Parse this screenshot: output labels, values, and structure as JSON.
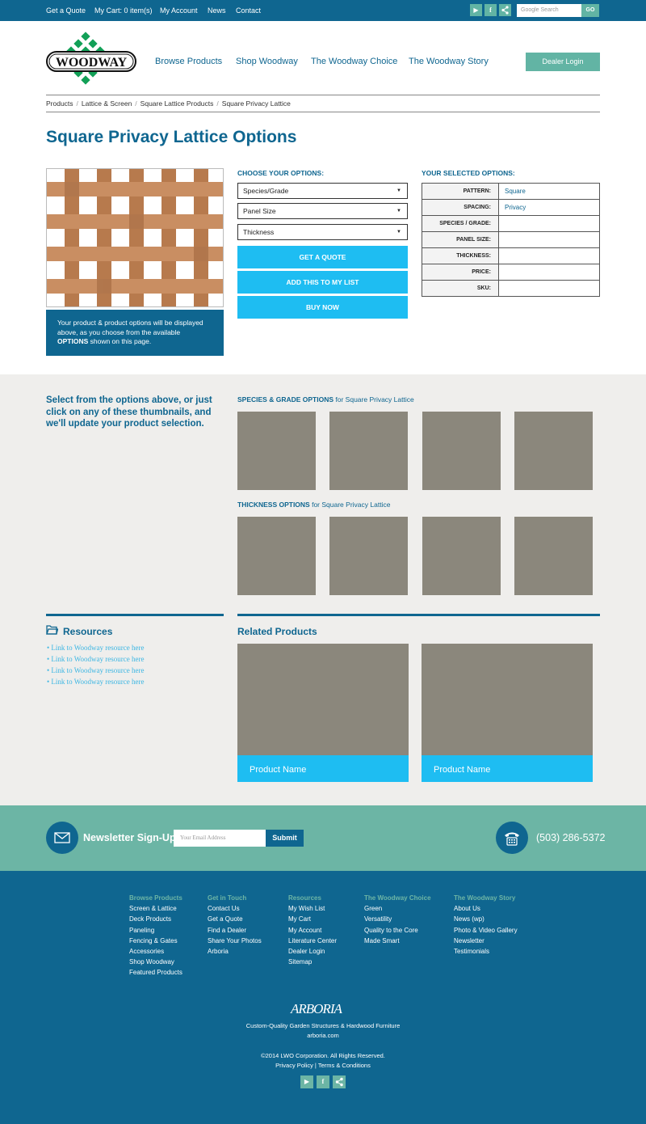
{
  "topbar": {
    "links": [
      "Get a Quote",
      "My Cart: 0 item(s)",
      "My Account",
      "News",
      "Contact"
    ],
    "social": [
      "youtube-icon",
      "facebook-icon",
      "share-icon"
    ],
    "search_placeholder": "Google Search",
    "go_label": "GO"
  },
  "header": {
    "logo_text": "WOODWAY",
    "nav": [
      "Browse Products",
      "Shop Woodway",
      "The Woodway Choice",
      "The Woodway Story"
    ],
    "dealer_login": "Dealer Login"
  },
  "breadcrumb": [
    "Products",
    "Lattice & Screen",
    "Square Lattice Products",
    "Square Privacy Lattice"
  ],
  "page_title": "Square Privacy Lattice Options",
  "product": {
    "info_pre": "Your product & product options will be displayed above, as you choose from the available ",
    "info_bold": "OPTIONS",
    "info_post": " shown on this page."
  },
  "choose": {
    "heading": "CHOOSE YOUR OPTIONS:",
    "selects": [
      "Species/Grade",
      "Panel Size",
      "Thickness"
    ],
    "buttons": [
      "GET A QUOTE",
      "ADD THIS TO MY LIST",
      "BUY NOW"
    ]
  },
  "selected": {
    "heading": "YOUR SELECTED OPTIONS:",
    "rows": [
      {
        "label": "PATTERN:",
        "value": "Square"
      },
      {
        "label": "SPACING:",
        "value": "Privacy"
      },
      {
        "label": "SPECIES / GRADE:",
        "value": ""
      },
      {
        "label": "PANEL SIZE:",
        "value": ""
      },
      {
        "label": "THICKNESS:",
        "value": ""
      },
      {
        "label": "PRICE:",
        "value": ""
      },
      {
        "label": "SKU:",
        "value": ""
      }
    ]
  },
  "thumbs": {
    "message": "Select from the options above, or just click on any of these thumbnails, and we'll update your product selection.",
    "species_bold": "SPECIES & GRADE OPTIONS",
    "species_rest": " for Square Privacy Lattice",
    "thickness_bold": "THICKNESS OPTIONS",
    "thickness_rest": " for Square Privacy Lattice"
  },
  "resources": {
    "heading": "Resources",
    "links": [
      "Link to Woodway resource here",
      "Link to Woodway resource here",
      "Link to Woodway resource here",
      "Link to Woodway resource here"
    ]
  },
  "related": {
    "heading": "Related Products",
    "items": [
      "Product Name",
      "Product Name"
    ]
  },
  "newsletter": {
    "heading": "Newsletter Sign-Up",
    "placeholder": "Your Email Address",
    "submit": "Submit",
    "phone": "(503) 286-5372"
  },
  "footer": {
    "columns": [
      {
        "heading": "Browse Products",
        "items": [
          "Screen & Lattice",
          "Deck Products",
          "Paneling",
          "Fencing & Gates",
          "Accessories",
          "Shop Woodway",
          "Featured Products"
        ]
      },
      {
        "heading": "Get in Touch",
        "items": [
          "Contact Us",
          "Get a Quote",
          "Find a Dealer",
          "Share Your Photos",
          "Arboria"
        ]
      },
      {
        "heading": "Resources",
        "items": [
          "My Wish List",
          "My Cart",
          "My Account",
          "Literature Center",
          "Dealer Login",
          "Sitemap"
        ]
      },
      {
        "heading": "The Woodway Choice",
        "items": [
          "Green",
          "Versatility",
          "Quality to the Core",
          "Made Smart"
        ]
      },
      {
        "heading": "The Woodway Story",
        "items": [
          "About Us",
          "News (wp)",
          "Photo & Video Gallery",
          "Newsletter",
          "Testimonials"
        ]
      }
    ],
    "arboria_logo": "ARBORIA",
    "arboria_tagline": "Custom-Quality Garden Structures & Hardwood Furniture",
    "arboria_url": "arboria.com",
    "copyright": "©2014 LWO Corporation. All Rights Reserved.",
    "privacy": "Privacy Policy",
    "terms": "Terms & Conditions",
    "separator": "|"
  }
}
